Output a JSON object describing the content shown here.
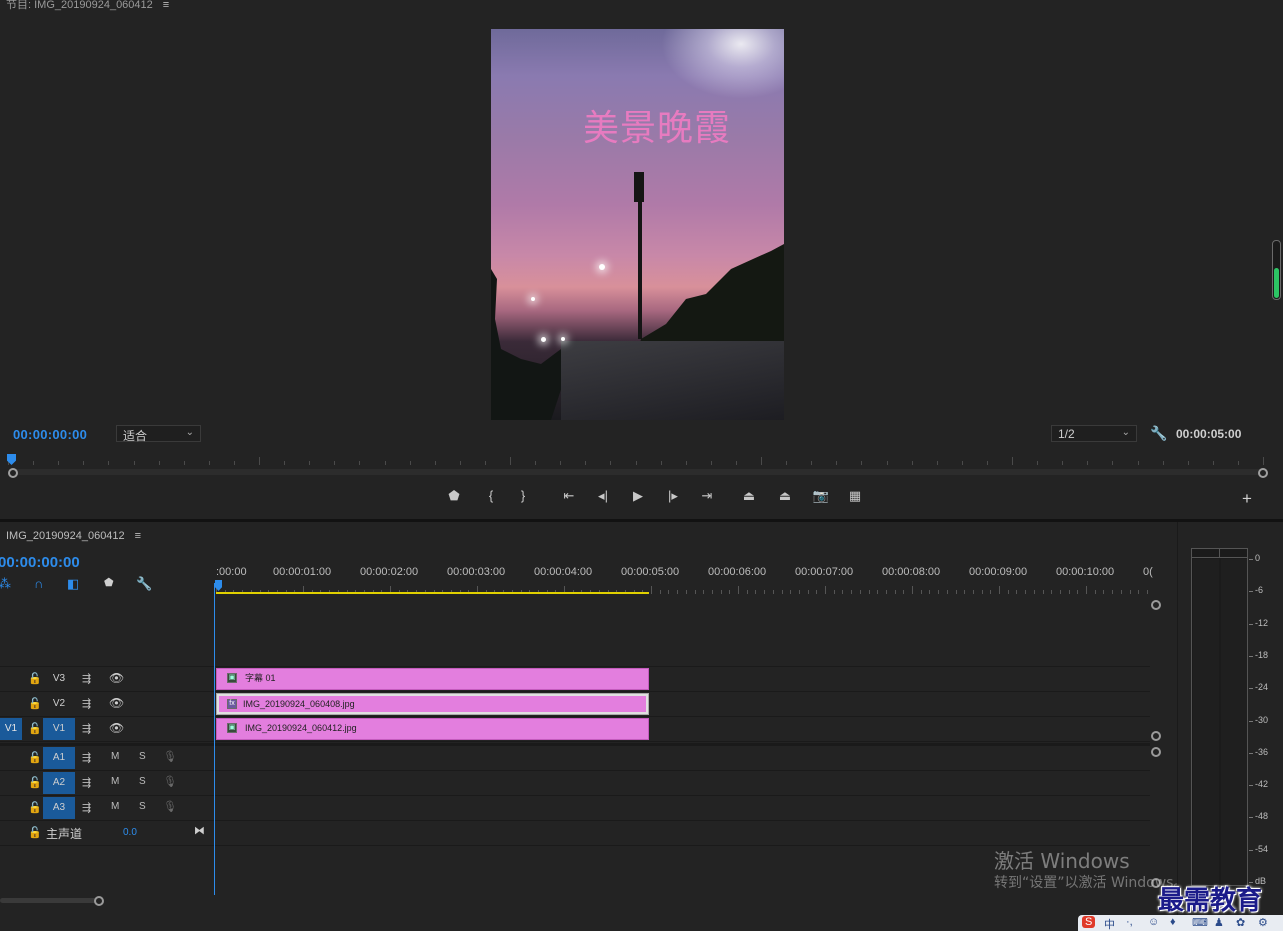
{
  "monitor": {
    "title": "节目: IMG_20190924_060412",
    "menu_icon": "hamburger-icon",
    "caption": "美景晚霞",
    "timecode_left": "00:00:00:00",
    "fit_label": "适合",
    "resolution_label": "1/2",
    "timecode_right": "00:00:05:00",
    "transport": [
      "marker-icon",
      "mark-in-icon",
      "mark-out-icon",
      "go-to-in-icon",
      "step-back-icon",
      "play-icon",
      "step-forward-icon",
      "go-to-out-icon",
      "lift-icon",
      "extract-icon",
      "export-frame-icon",
      "compare-icon"
    ],
    "add_button": "+"
  },
  "timeline": {
    "sequence_name": "IMG_20190924_060412",
    "timecode": "00:00:00:00",
    "ruler_labels": [
      ":00:00",
      "00:00:01:00",
      "00:00:02:00",
      "00:00:03:00",
      "00:00:04:00",
      "00:00:05:00",
      "00:00:06:00",
      "00:00:07:00",
      "00:00:08:00",
      "00:00:09:00",
      "00:00:10:00",
      "0("
    ],
    "video_tracks": [
      {
        "name": "V3",
        "source": ""
      },
      {
        "name": "V2",
        "source": ""
      },
      {
        "name": "V1",
        "source": "V1"
      }
    ],
    "audio_tracks": [
      {
        "name": "A1",
        "m": "M",
        "s": "S"
      },
      {
        "name": "A2",
        "m": "M",
        "s": "S"
      },
      {
        "name": "A3",
        "m": "M",
        "s": "S"
      }
    ],
    "master": {
      "label": "主声道",
      "value": "0.0"
    },
    "clips": {
      "v3": "字幕 01",
      "v2": "IMG_20190924_060408.jpg",
      "v2_badge": "fx",
      "v1": "IMG_20190924_060412.jpg"
    }
  },
  "meter": {
    "labels": [
      "0",
      "-6",
      "-12",
      "-18",
      "-24",
      "-30",
      "-36",
      "-42",
      "-48",
      "-54",
      "dB"
    ]
  },
  "watermark": {
    "line1": "激活 Windows",
    "line2": "转到“设置”以激活 Windows。"
  },
  "brand": "最需教育",
  "taskbar": [
    "S",
    "中",
    "·,",
    "☺",
    "♦",
    "⌨",
    "♟",
    "✿",
    "⚙"
  ]
}
